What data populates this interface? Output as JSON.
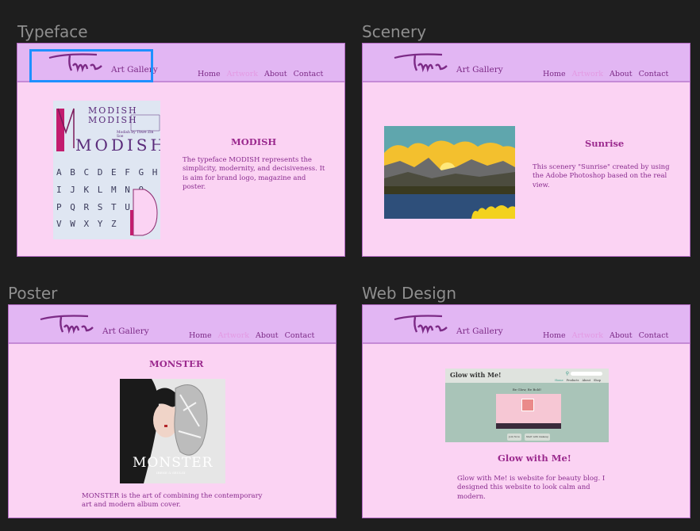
{
  "nav_items": [
    "Home",
    "Artwork",
    "About",
    "Contact"
  ],
  "brand": "Art Gallery",
  "typeface": {
    "label": "Typeface",
    "heading": "MODISH",
    "description": "The typeface MODISH represents the simplicity, modernity, and  decisiveness. It is aim for brand logo, magazine and poster.",
    "poster_title": "MODISH",
    "poster_sub": "Modish by Thwe Zin Soe",
    "letters": [
      "A B C D E F G H",
      "I J K L M N O",
      "P Q R S T U",
      "V W X Y Z"
    ]
  },
  "scenery": {
    "label": "Scenery",
    "heading": "Sunrise",
    "description": "This scenery \"Sunrise\" created by using the Adobe Photoshop based on the real view."
  },
  "poster": {
    "label": "Poster",
    "heading": "MONSTER",
    "description": "MONSTER is the art of combining the contemporary art and modern album cover.",
    "cover_text": "MONSTER",
    "cover_sub": "IRENE & SEULGI"
  },
  "web": {
    "label": "Web Design",
    "heading": "Glow with Me!",
    "description": "Glow with Me! is website for beauty blog. I designed this website to look calm and modern.",
    "site_title": "Glow with Me!",
    "site_tagline": "Be Glow, Be Bold!",
    "site_nav": [
      "Home",
      "Products",
      "About",
      "Shop"
    ],
    "btn1": "Join Now",
    "btn2": "Start with makeup"
  },
  "colors": {
    "background": "#1e1e1e",
    "page": "#fbd3f3",
    "header": "#e2b6f3",
    "accent": "#9b2a8e",
    "selection": "#1e90ff"
  }
}
